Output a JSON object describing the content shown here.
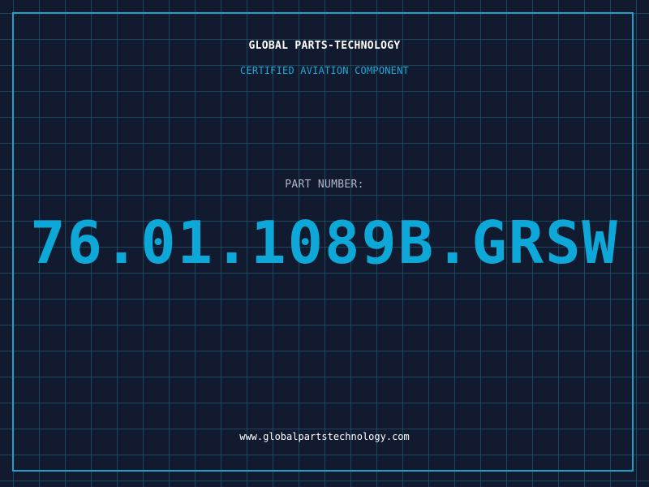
{
  "header": {
    "company": "GLOBAL PARTS-TECHNOLOGY",
    "tagline": "CERTIFIED AVIATION COMPONENT"
  },
  "part": {
    "label": "PART NUMBER:",
    "number": "76.01.1089B.GRSW"
  },
  "footer": {
    "website": "www.globalpartstechnology.com"
  },
  "colors": {
    "background": "#111a2e",
    "grid": "#1f6c86",
    "frame": "#1f9fc4",
    "accent": "#0ea8d8",
    "label": "#aeb8c8",
    "text": "#ffffff"
  }
}
